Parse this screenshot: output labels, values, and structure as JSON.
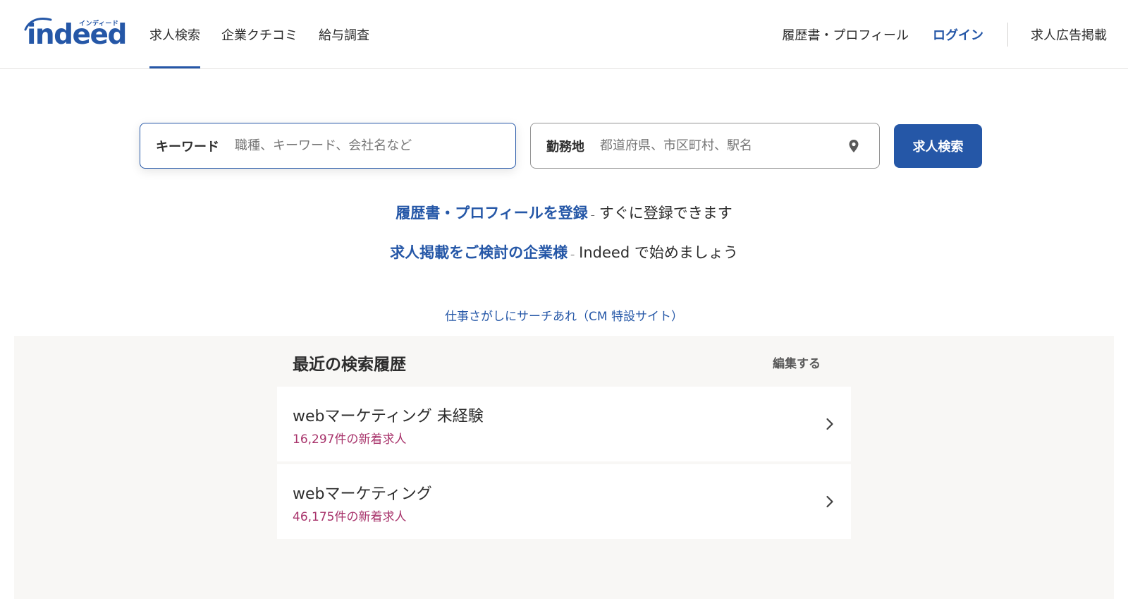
{
  "brand": {
    "logo_text": "indeed",
    "logo_kana": "インディード",
    "color": "#2557a7"
  },
  "nav": {
    "left": [
      {
        "label": "求人検索",
        "active": true
      },
      {
        "label": "企業クチコミ",
        "active": false
      },
      {
        "label": "給与調査",
        "active": false
      }
    ],
    "right": {
      "resume": "履歴書・プロフィール",
      "login": "ログイン",
      "post_job": "求人広告掲載"
    }
  },
  "search": {
    "keyword_label": "キーワード",
    "keyword_placeholder": "職種、キーワード、会社名など",
    "location_label": "勤務地",
    "location_placeholder": "都道府県、市区町村、駅名",
    "location_icon": "map-pin-icon",
    "button_label": "求人検索"
  },
  "promos": [
    {
      "link": "履歴書・プロフィールを登録",
      "separator": "–",
      "text": "すぐに登録できます"
    },
    {
      "link": "求人掲載をご検討の企業様",
      "separator": "–",
      "text": "Indeed で始めましょう"
    }
  ],
  "cm_link": "仕事さがしにサーチあれ（CM 特設サイト）",
  "recent": {
    "title": "最近の検索履歴",
    "edit_label": "編集する",
    "items": [
      {
        "query": "webマーケティング 未経験",
        "count": "16,297件の新着求人"
      },
      {
        "query": "webマーケティング",
        "count": "46,175件の新着求人"
      }
    ],
    "count_color": "#a8336b",
    "chevron_icon": "chevron-right-icon"
  }
}
